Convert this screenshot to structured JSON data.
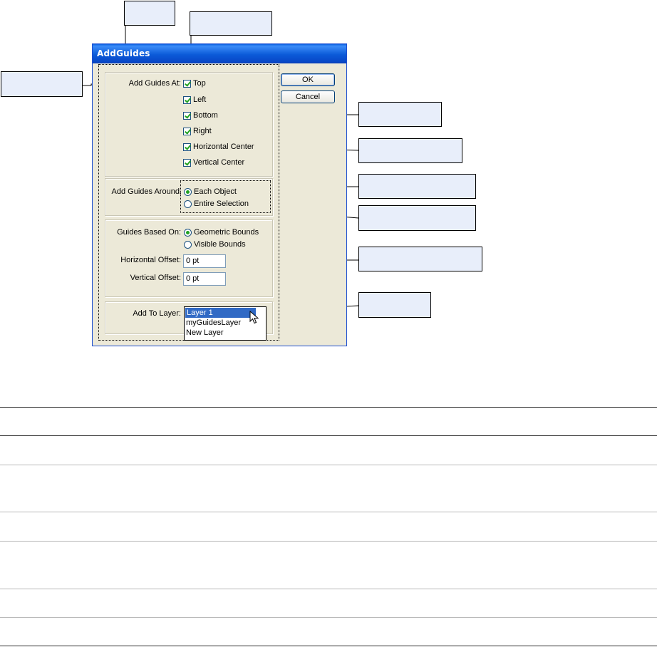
{
  "dialog": {
    "title": "AddGuides",
    "add_guides_at_label": "Add Guides At:",
    "checkboxes": [
      "Top",
      "Left",
      "Bottom",
      "Right",
      "Horizontal Center",
      "Vertical Center"
    ],
    "add_guides_around_label": "Add Guides Around:",
    "around_options": [
      "Each Object",
      "Entire Selection"
    ],
    "guides_based_on_label": "Guides Based On:",
    "based_on_options": [
      "Geometric Bounds",
      "Visible Bounds"
    ],
    "horizontal_offset_label": "Horizontal Offset:",
    "horizontal_offset_value": "0 pt",
    "vertical_offset_label": "Vertical Offset:",
    "vertical_offset_value": "0 pt",
    "add_to_layer_label": "Add To Layer:",
    "layer_options": [
      "Layer 1",
      "myGuidesLayer",
      "New Layer"
    ],
    "ok_label": "OK",
    "cancel_label": "Cancel"
  }
}
